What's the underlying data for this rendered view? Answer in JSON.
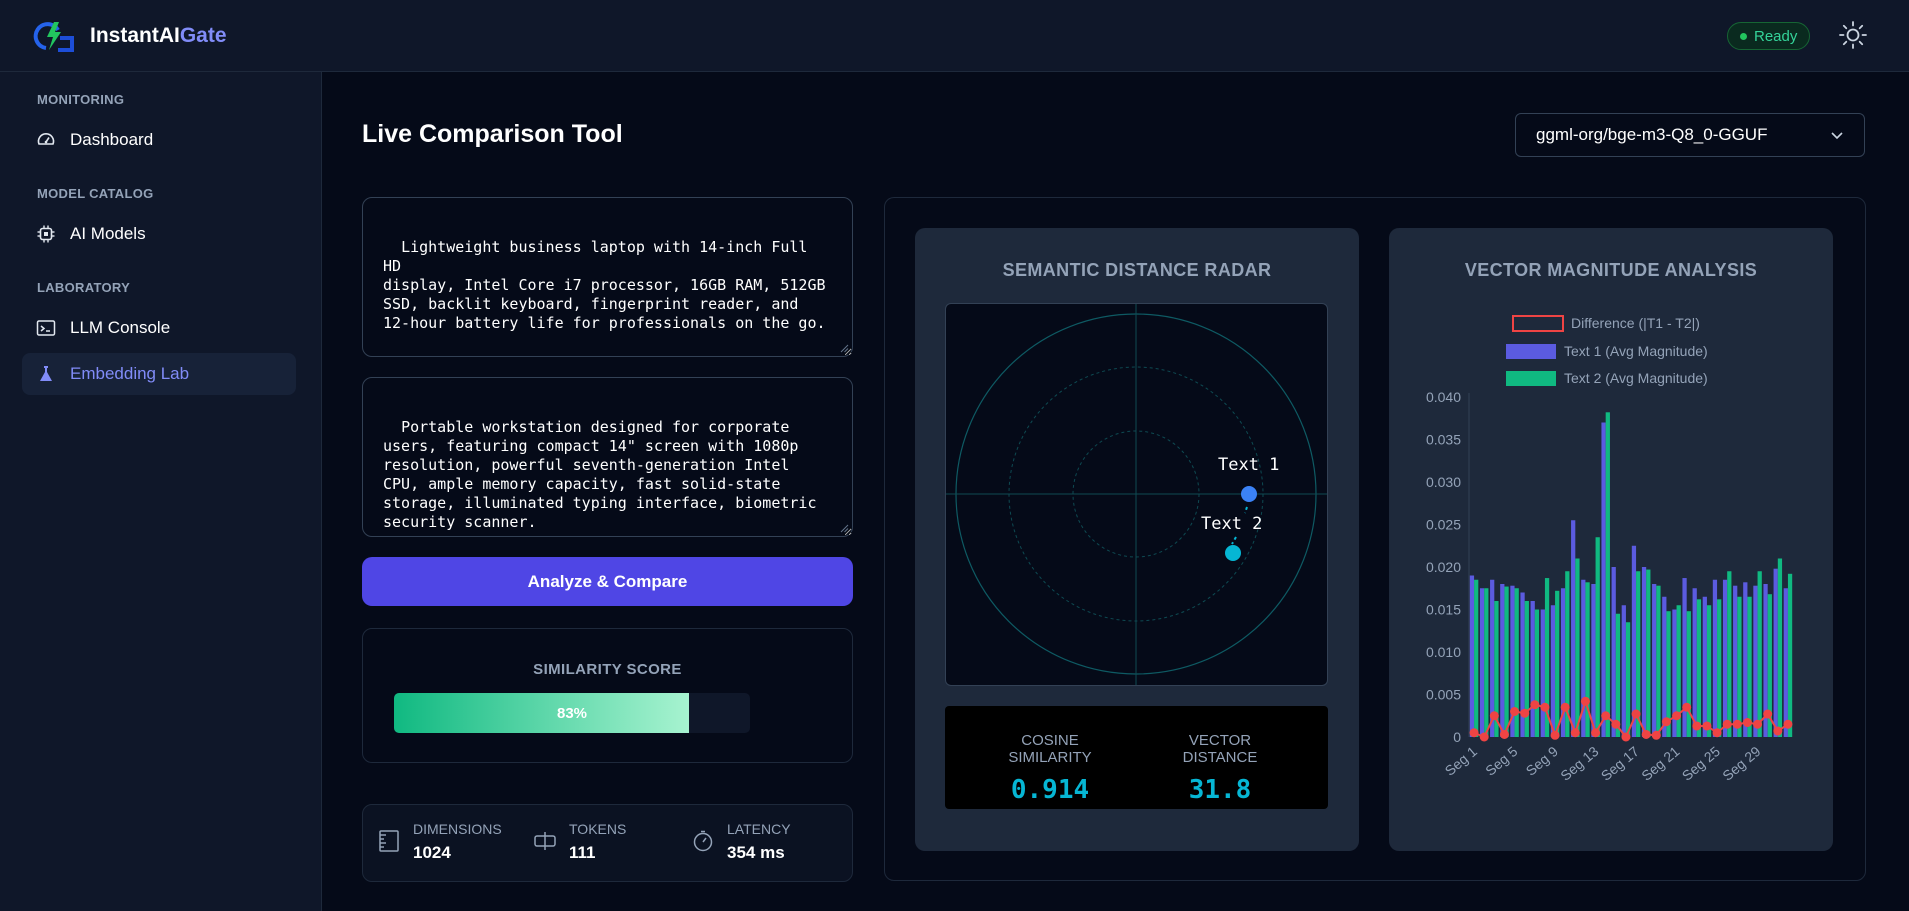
{
  "app": {
    "brand_main": "InstantAI",
    "brand_accent": "Gate",
    "status": "Ready"
  },
  "sidebar": {
    "sections": [
      {
        "title": "MONITORING",
        "items": [
          {
            "label": "Dashboard",
            "icon": "gauge-icon"
          }
        ]
      },
      {
        "title": "MODEL CATALOG",
        "items": [
          {
            "label": "AI Models",
            "icon": "cpu-chip-icon"
          }
        ]
      },
      {
        "title": "LABORATORY",
        "items": [
          {
            "label": "LLM Console",
            "icon": "terminal-icon"
          },
          {
            "label": "Embedding Lab",
            "icon": "flask-icon",
            "active": true
          }
        ]
      }
    ]
  },
  "main": {
    "title": "Live Comparison Tool",
    "model_select": "ggml-org/bge-m3-Q8_0-GGUF",
    "text1": "Lightweight business laptop with 14-inch Full HD\ndisplay, Intel Core i7 processor, 16GB RAM, 512GB\nSSD, backlit keyboard, fingerprint reader, and\n12-hour battery life for professionals on the go.",
    "text2": "Portable workstation designed for corporate\nusers, featuring compact 14\" screen with 1080p\nresolution, powerful seventh-generation Intel\nCPU, ample memory capacity, fast solid-state\nstorage, illuminated typing interface, biometric\nsecurity scanner.",
    "analyze_label": "Analyze & Compare",
    "similarity": {
      "title": "SIMILARITY SCORE",
      "value": 0.83,
      "label": "83%"
    },
    "stats": [
      {
        "label": "DIMENSIONS",
        "value": "1024",
        "icon": "ruler-icon"
      },
      {
        "label": "TOKENS",
        "value": "111",
        "icon": "token-split-icon"
      },
      {
        "label": "LATENCY",
        "value": "354 ms",
        "icon": "stopwatch-icon"
      }
    ]
  },
  "radar": {
    "title": "SEMANTIC DISTANCE RADAR",
    "points": [
      {
        "label": "Text 1",
        "color": "#3b82f6"
      },
      {
        "label": "Text 2",
        "color": "#06b6d4"
      }
    ],
    "cosine_label": "COSINE SIMILARITY",
    "cosine_value": "0.914",
    "distance_label": "VECTOR DISTANCE",
    "distance_value": "31.8"
  },
  "chart_data": {
    "type": "bar",
    "title": "VECTOR MAGNITUDE ANALYSIS",
    "x": [
      1,
      2,
      3,
      4,
      5,
      6,
      7,
      8,
      9,
      10,
      11,
      12,
      13,
      14,
      15,
      16,
      17,
      18,
      19,
      20,
      21,
      22,
      23,
      24,
      25,
      26,
      27,
      28,
      29,
      30,
      31,
      32
    ],
    "xtick_labels": [
      "Seg 1",
      "Seg 5",
      "Seg 9",
      "Seg 13",
      "Seg 17",
      "Seg 21",
      "Seg 25",
      "Seg 29"
    ],
    "ylim": [
      0,
      0.04
    ],
    "yticks": [
      "0",
      "0.005",
      "0.010",
      "0.015",
      "0.020",
      "0.025",
      "0.030",
      "0.035",
      "0.040"
    ],
    "series": [
      {
        "name": "Text 1 (Avg Magnitude)",
        "type": "bar",
        "color": "#5b5be0",
        "values": [
          0.019,
          0.0175,
          0.0185,
          0.018,
          0.0178,
          0.017,
          0.016,
          0.015,
          0.0155,
          0.0175,
          0.0255,
          0.0185,
          0.018,
          0.037,
          0.02,
          0.0155,
          0.0225,
          0.02,
          0.018,
          0.0165,
          0.015,
          0.0187,
          0.0175,
          0.0165,
          0.0185,
          0.0185,
          0.0178,
          0.0182,
          0.0178,
          0.018,
          0.0198,
          0.0175
        ]
      },
      {
        "name": "Text 2 (Avg Magnitude)",
        "type": "bar",
        "color": "#10b981",
        "values": [
          0.0185,
          0.0175,
          0.016,
          0.0177,
          0.0175,
          0.016,
          0.015,
          0.0187,
          0.0172,
          0.0195,
          0.021,
          0.0182,
          0.0235,
          0.0382,
          0.0145,
          0.0135,
          0.0195,
          0.0197,
          0.0178,
          0.0148,
          0.0155,
          0.0148,
          0.0162,
          0.0155,
          0.0162,
          0.0195,
          0.0165,
          0.0165,
          0.0195,
          0.0168,
          0.021,
          0.0192
        ]
      },
      {
        "name": "Difference (|T1 - T2|)",
        "type": "line",
        "color": "#ef4444",
        "values": [
          0.0005,
          0.0,
          0.0025,
          0.0003,
          0.003,
          0.0028,
          0.0038,
          0.0035,
          0.0002,
          0.0035,
          0.0005,
          0.0042,
          0.0005,
          0.0025,
          0.0015,
          0.0,
          0.0027,
          0.0003,
          0.0002,
          0.0018,
          0.0025,
          0.0035,
          0.0013,
          0.0013,
          0.0005,
          0.0015,
          0.0015,
          0.0017,
          0.0015,
          0.0027,
          0.0007,
          0.0015
        ]
      }
    ],
    "legend_placement": "top"
  }
}
